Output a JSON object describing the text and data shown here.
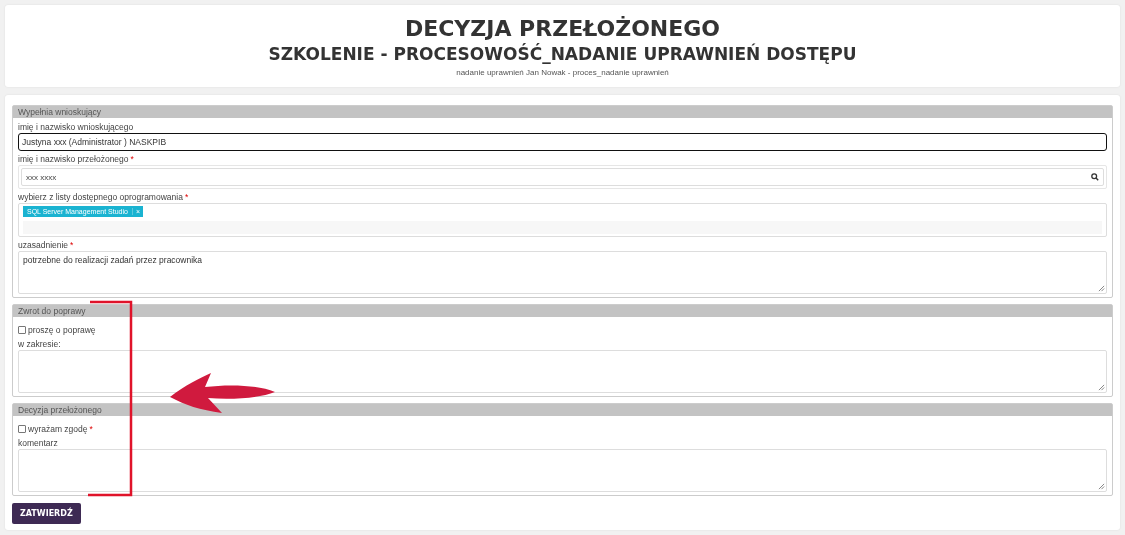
{
  "header": {
    "title": "DECYZJA PRZEŁOŻONEGO",
    "subtitle": "SZKOLENIE - PROCESOWOŚĆ_NADANIE UPRAWNIEŃ DOSTĘPU",
    "caption": "nadanie uprawnień Jan Nowak - proces_nadanie uprawnień"
  },
  "sections": [
    {
      "title": "Wypełnia wnioskujący",
      "fields": [
        {
          "kind": "text",
          "label": "imię i nazwisko wnioskującego",
          "value": "Justyna xxx (Administrator ) NASKPIB",
          "focused": true
        },
        {
          "kind": "lookup",
          "label": "imię i nazwisko przełożonego",
          "required_mark": "*",
          "value": "xxx xxxx"
        },
        {
          "kind": "tags",
          "label": "wybierz z listy dostępnego oprogramowania",
          "required_mark": "*",
          "tags": [
            {
              "label": "SQL Server Management Studio",
              "remove": "×"
            }
          ]
        },
        {
          "kind": "textarea",
          "label": "uzasadnienie",
          "required_mark": "*",
          "value": "potrzebne do realizacji zadań przez pracownika"
        }
      ]
    },
    {
      "title": "Zwrot do poprawy",
      "fields": [
        {
          "kind": "checkbox",
          "label": "proszę o poprawę",
          "checked": false
        },
        {
          "kind": "textarea",
          "label": "w zakresie:"
        }
      ]
    },
    {
      "title": "Decyzja przełożonego",
      "fields": [
        {
          "kind": "checkbox",
          "label": "wyrażam zgodę",
          "required_mark": "*",
          "checked": false
        },
        {
          "kind": "textarea",
          "label": "komentarz"
        }
      ]
    }
  ],
  "submit": "ZATWIERDŹ",
  "annotations": [
    {
      "kind": "bracket",
      "color": "#e0132a"
    },
    {
      "kind": "arrow",
      "color": "#d01a3e"
    }
  ]
}
